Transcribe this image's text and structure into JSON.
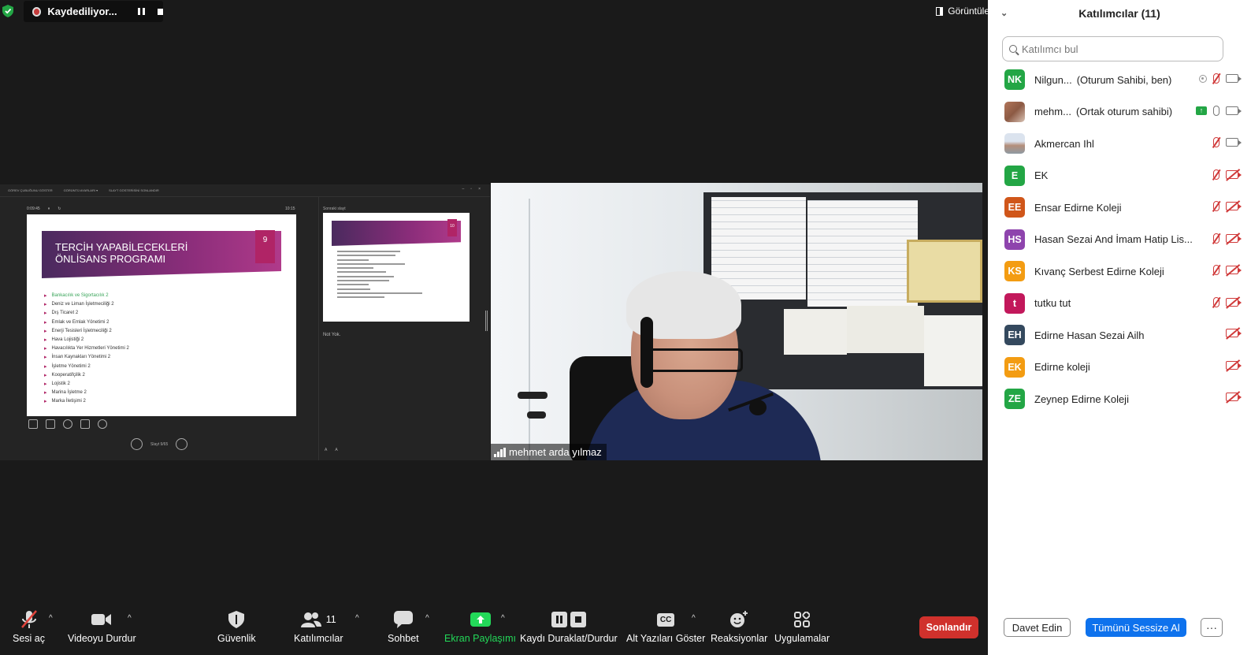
{
  "recording": {
    "label": "Kaydediliyor..."
  },
  "view_button": {
    "label": "Görüntüle"
  },
  "slide_show": {
    "timer": "0:09:45",
    "clock": "10:15",
    "toolbar_items": [
      "GÖREV ÇUBUĞUNU GÖSTER",
      "GÖRÜNTÜ AYARLARI ▾",
      "SLAYT GÖSTERİSİNİ SONLANDIR"
    ],
    "current": {
      "title_line1": "TERCİH YAPABİLECEKLERİ",
      "title_line2": "ÖNLİSANS PROGRAMI",
      "number": "9",
      "items": [
        "Bankacılık ve Sigortacılık 2",
        "Deniz ve Liman İşletmeciliği 2",
        "Dış Ticaret 2",
        "Emlak ve Emlak Yönetimi 2",
        "Enerji Tesisleri İşletmeciliği 2",
        "Hava Lojistiği 2",
        "Havacılıkta Yer Hizmetleri Yönetimi 2",
        "İnsan Kaynakları Yönetimi 2",
        "İşletme Yönetimi 2",
        "Kooperatifçilik 2",
        "Lojistik 2",
        "Marina İşletme 2",
        "Marka İletişimi 2"
      ]
    },
    "nav_label": "Slayt 9/65",
    "next_label": "Sonraki slayt",
    "next_number": "10",
    "notes": "Not Yok."
  },
  "video": {
    "participant_name": "mehmet arda yılmaz"
  },
  "toolbar": {
    "mute": "Sesi aç",
    "video": "Videoyu Durdur",
    "security": "Güvenlik",
    "participants": "Katılımcılar",
    "participants_count": "11",
    "chat": "Sohbet",
    "share": "Ekran Paylaşımı",
    "record": "Kaydı Duraklat/Durdur",
    "cc_badge": "CC",
    "captions": "Alt Yazıları Göster",
    "reactions": "Reaksiyonlar",
    "apps": "Uygulamalar",
    "end": "Sonlandır"
  },
  "colors": {
    "accent": "#0e72ed",
    "end": "#d0312c",
    "share": "#23d959",
    "slide_accent": "#b02466"
  },
  "panel": {
    "title": "Katılımcılar (11)",
    "search_placeholder": "Katılımcı bul",
    "participants": [
      {
        "initials": "NK",
        "name": "Nilgun...",
        "role": "(Oturum Sahibi, ben)",
        "color": "#23a645",
        "mic": "off",
        "cam": "on",
        "recording": true
      },
      {
        "initials": "",
        "name": "mehm...",
        "role": "(Ortak oturum sahibi)",
        "color": "photo",
        "mic": "on",
        "cam": "on",
        "sharing": true
      },
      {
        "initials": "",
        "name": "Akmercan Ihl",
        "role": "",
        "color": "photo",
        "mic": "off",
        "cam": "on"
      },
      {
        "initials": "E",
        "name": "EK",
        "role": "",
        "color": "#23a645",
        "mic": "off",
        "cam": "off"
      },
      {
        "initials": "EE",
        "name": "Ensar Edirne Koleji",
        "role": "",
        "color": "#d0561a",
        "mic": "off",
        "cam": "off"
      },
      {
        "initials": "HS",
        "name": "Hasan Sezai And İmam Hatip Lis...",
        "role": "",
        "color": "#8e44ad",
        "mic": "off",
        "cam": "off"
      },
      {
        "initials": "KS",
        "name": "Kıvanç Serbest Edirne Koleji",
        "role": "",
        "color": "#f39c12",
        "mic": "off",
        "cam": "off"
      },
      {
        "initials": "t",
        "name": "tutku tut",
        "role": "",
        "color": "#c2185b",
        "mic": "off",
        "cam": "off"
      },
      {
        "initials": "EH",
        "name": "Edirne Hasan Sezai Ailh",
        "role": "",
        "color": "#34495e",
        "mic": "none",
        "cam": "off"
      },
      {
        "initials": "EK",
        "name": "Edirne koleji",
        "role": "",
        "color": "#f39c12",
        "mic": "none",
        "cam": "off"
      },
      {
        "initials": "ZE",
        "name": "Zeynep Edirne Koleji",
        "role": "",
        "color": "#23a645",
        "mic": "none",
        "cam": "off"
      }
    ],
    "invite": "Davet Edin",
    "mute_all": "Tümünü Sessize Al",
    "more": "···"
  }
}
